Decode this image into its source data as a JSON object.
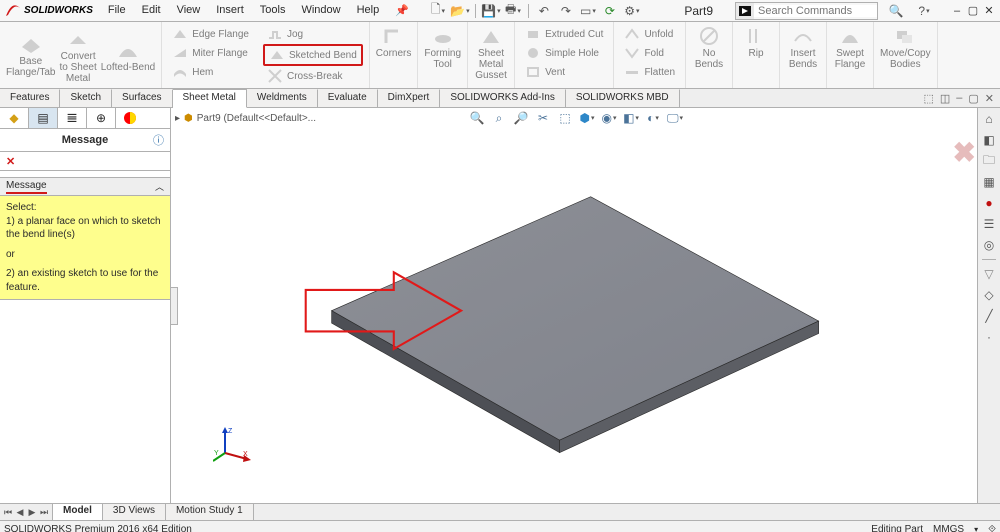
{
  "title": {
    "logo_text": "SOLIDWORKS"
  },
  "main_menu": [
    "File",
    "Edit",
    "View",
    "Insert",
    "Tools",
    "Window",
    "Help"
  ],
  "doc_name": "Part9",
  "search": {
    "placeholder": "Search Commands"
  },
  "ribbon": {
    "g1": {
      "a": "Base\nFlange/Tab",
      "b": "Convert\nto Sheet\nMetal",
      "c": "Lofted-Bend"
    },
    "g2": {
      "a": "Edge Flange",
      "b": "Miter Flange",
      "c": "Hem",
      "d": "Jog",
      "e": "Sketched Bend",
      "f": "Cross-Break"
    },
    "g3": {
      "a": "Corners"
    },
    "g4": {
      "a": "Forming\nTool"
    },
    "g5": {
      "a": "Sheet\nMetal\nGusset"
    },
    "g6": {
      "a": "Extruded Cut",
      "b": "Simple Hole",
      "c": "Vent"
    },
    "g7": {
      "a": "Unfold",
      "b": "Fold",
      "c": "Flatten"
    },
    "g8": {
      "a": "No\nBends"
    },
    "g9": {
      "a": "Rip"
    },
    "g10": {
      "a": "Insert\nBends"
    },
    "g11": {
      "a": "Swept\nFlange"
    },
    "g12": {
      "a": "Move/Copy\nBodies"
    }
  },
  "cmd_tabs": [
    "Features",
    "Sketch",
    "Surfaces",
    "Sheet Metal",
    "Weldments",
    "Evaluate",
    "DimXpert",
    "SOLIDWORKS Add-Ins",
    "SOLIDWORKS MBD"
  ],
  "cmd_tabs_active": 3,
  "panel": {
    "title": "Message",
    "msg_header": "Message",
    "select_label": "Select:",
    "opt1": "1) a planar face on which to sketch the bend line(s)",
    "or": "or",
    "opt2": "2) an existing sketch to use for the feature."
  },
  "tree_text": "Part9  (Default<<Default>...",
  "view_tabs": [
    "Model",
    "3D Views",
    "Motion Study 1"
  ],
  "view_tabs_active": 0,
  "status": {
    "left": "SOLIDWORKS Premium 2016 x64 Edition",
    "mode": "Editing Part",
    "units": "MMGS"
  }
}
